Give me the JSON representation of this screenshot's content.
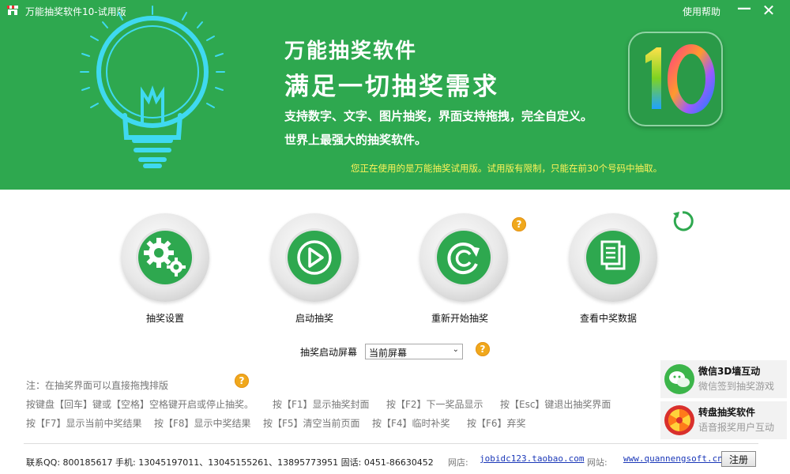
{
  "window": {
    "title": "万能抽奖软件10-试用版",
    "help": "使用帮助",
    "minimize": "—",
    "close": "✕"
  },
  "header": {
    "title1": "万能抽奖软件",
    "title2": "满足一切抽奖需求",
    "desc1": "支持数字、文字、图片抽奖，界面支持拖拽，完全自定义。",
    "desc2": "世界上最强大的抽奖软件。",
    "notice": "您正在使用的是万能抽奖试用版。试用版有限制，只能在前30个号码中抽取。",
    "logo_text": "10"
  },
  "actions": [
    {
      "label": "抽奖设置",
      "icon": "gears-icon"
    },
    {
      "label": "启动抽奖",
      "icon": "play-icon"
    },
    {
      "label": "重新开始抽奖",
      "icon": "restart-icon"
    },
    {
      "label": "查看中奖数据",
      "icon": "documents-icon"
    }
  ],
  "screen": {
    "label": "抽奖启动屏幕",
    "selected": "当前屏幕"
  },
  "hints": {
    "note": "注：在抽奖界面可以直接拖拽排版",
    "line1": [
      "按键盘【回车】键或【空格】空格键开启或停止抽奖。",
      "按【F1】显示抽奖封面",
      "按【F2】下一奖品显示",
      "按【Esc】键退出抽奖界面"
    ],
    "line2": [
      "按【F7】显示当前中奖结果",
      "按【F8】显示中奖结果",
      "按【F5】清空当前页面",
      "按【F4】临时补奖",
      "按【F6】弃奖"
    ]
  },
  "footer": {
    "contact": "联系QQ: 800185617  手机: 13045197011、13045155261、13895773951  固话: 0451-86630452",
    "shop_label": "网店:",
    "shop_link": "jobidc123.taobao.com",
    "site_label": "网站:",
    "site_link": "www.quannengsoft.cn",
    "register": "注册"
  },
  "promos": [
    {
      "title": "微信3D墙互动",
      "subtitle": "微信签到抽奖游戏"
    },
    {
      "title": "转盘抽奖软件",
      "subtitle": "语音报奖用户互动"
    }
  ],
  "help_badge": "?",
  "colors": {
    "brand_green": "#2ea84f",
    "notice_yellow": "#fff35a",
    "link_blue": "#1a37b8",
    "help_orange": "#f0a81c"
  }
}
